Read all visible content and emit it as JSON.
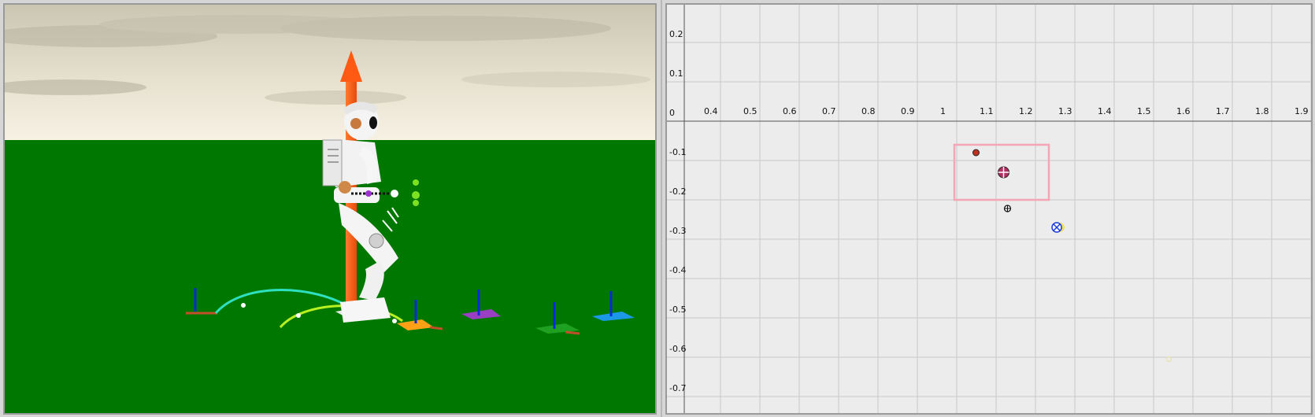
{
  "simulation_view": {
    "sky_colors": [
      "#d2cdb8",
      "#f3eee0"
    ],
    "ground_color": "#007800",
    "force_arrow_color": "#ff5a14"
  },
  "plot": {
    "x_ticks": [
      "0.4",
      "0.5",
      "0.6",
      "0.7",
      "0.8",
      "0.9",
      "1",
      "1.1",
      "1.2",
      "1.3",
      "1.4",
      "1.5",
      "1.6",
      "1.7",
      "1.8",
      "1.9"
    ],
    "y_ticks": [
      "0.2",
      "0.1",
      "0",
      "-0.1",
      "-0.2",
      "-0.3",
      "-0.4",
      "-0.5",
      "-0.6",
      "-0.7"
    ],
    "support_box_color": "#f4a6b4",
    "grid_color": "#c9c9c9",
    "markers": {
      "icp": {
        "x": 1.095,
        "y": -0.09
      },
      "com_projection": {
        "x": 1.165,
        "y": -0.14
      },
      "cmp": {
        "x": 1.175,
        "y": -0.232
      },
      "desired_icp": {
        "x": 1.3,
        "y": -0.28
      },
      "faint_point": {
        "x": 1.585,
        "y": -0.615
      }
    }
  }
}
